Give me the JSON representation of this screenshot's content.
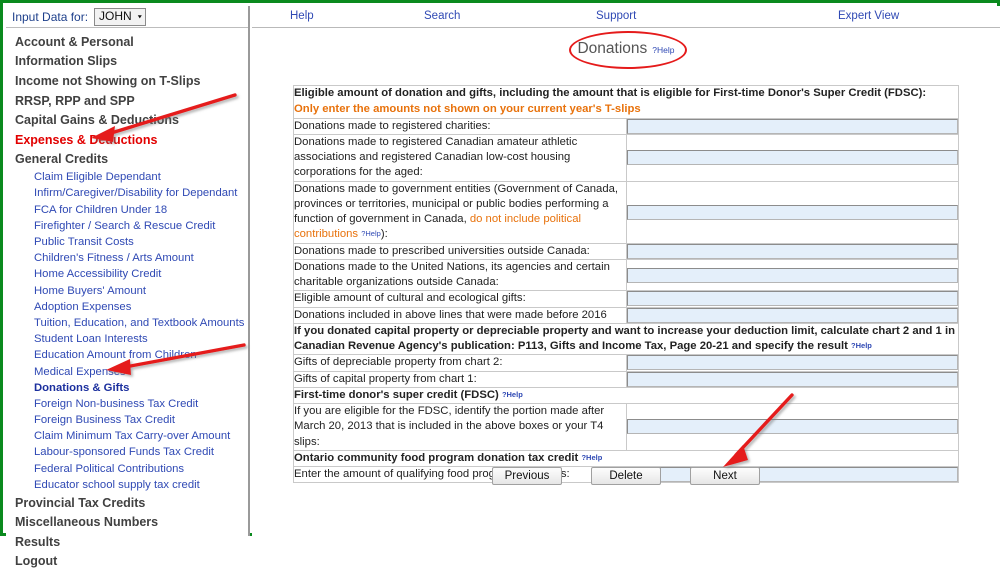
{
  "window": {
    "frame_color": "#0a8a1e",
    "annotation_color": "#e51b1b"
  },
  "input_bar": {
    "label": "Input Data for:",
    "selected_user": "JOHN",
    "caret": "▾"
  },
  "topnav": {
    "items": [
      {
        "label": "Help"
      },
      {
        "label": "Search"
      },
      {
        "label": "Support"
      },
      {
        "label": "Expert View"
      }
    ]
  },
  "sidebar": {
    "items": [
      {
        "label": "Account & Personal",
        "level": "top",
        "active": false
      },
      {
        "label": "Information Slips",
        "level": "top",
        "active": false
      },
      {
        "label": "Income not Showing on T-Slips",
        "level": "top",
        "active": false
      },
      {
        "label": "RRSP, RPP and SPP",
        "level": "top",
        "active": false
      },
      {
        "label": "Capital Gains & Deductions",
        "level": "top",
        "active": false
      },
      {
        "label": "Expenses & Deductions",
        "level": "top",
        "active": true
      },
      {
        "label": "General Credits",
        "level": "top",
        "active": false
      },
      {
        "label": "Claim Eligible Dependant",
        "level": "sub",
        "active": false
      },
      {
        "label": "Infirm/Caregiver/Disability for Dependant",
        "level": "sub",
        "active": false
      },
      {
        "label": "FCA for Children Under 18",
        "level": "sub",
        "active": false
      },
      {
        "label": "Firefighter / Search & Rescue Credit",
        "level": "sub",
        "active": false
      },
      {
        "label": "Public Transit Costs",
        "level": "sub",
        "active": false
      },
      {
        "label": "Children's Fitness / Arts Amount",
        "level": "sub",
        "active": false
      },
      {
        "label": "Home Accessibility Credit",
        "level": "sub",
        "active": false
      },
      {
        "label": "Home Buyers' Amount",
        "level": "sub",
        "active": false
      },
      {
        "label": "Adoption Expenses",
        "level": "sub",
        "active": false
      },
      {
        "label": "Tuition, Education, and Textbook Amounts",
        "level": "sub",
        "active": false
      },
      {
        "label": "Student Loan Interests",
        "level": "sub",
        "active": false
      },
      {
        "label": "Education Amount from Children",
        "level": "sub",
        "active": false
      },
      {
        "label": "Medical Expenses",
        "level": "sub",
        "active": false
      },
      {
        "label": "Donations & Gifts",
        "level": "sub",
        "active": true
      },
      {
        "label": "Foreign Non-business Tax Credit",
        "level": "sub",
        "active": false
      },
      {
        "label": "Foreign Business Tax Credit",
        "level": "sub",
        "active": false
      },
      {
        "label": "Claim Minimum Tax Carry-over Amount",
        "level": "sub",
        "active": false
      },
      {
        "label": "Labour-sponsored Funds Tax Credit",
        "level": "sub",
        "active": false
      },
      {
        "label": "Federal Political Contributions",
        "level": "sub",
        "active": false
      },
      {
        "label": "Educator school supply tax credit",
        "level": "sub",
        "active": false
      },
      {
        "label": "Provincial Tax Credits",
        "level": "top",
        "active": false
      },
      {
        "label": "Miscellaneous Numbers",
        "level": "top",
        "active": false
      },
      {
        "label": "Results",
        "level": "top",
        "active": false
      },
      {
        "label": "Logout",
        "level": "top",
        "active": false
      }
    ]
  },
  "page": {
    "title": "Donations",
    "title_help": "?Help"
  },
  "form": {
    "rows": [
      {
        "type": "section",
        "label": "Eligible amount of donation and gifts, including the amount that is eligible for First-time Donor's Super Credit (FDSC):",
        "sublabel": "Only enter the amounts not shown on your current year's T-slips",
        "bold": true,
        "field": false,
        "value": ""
      },
      {
        "type": "field",
        "label": "Donations made to registered charities:",
        "bold": false,
        "field": true,
        "value": ""
      },
      {
        "type": "field",
        "label": "Donations made to registered Canadian amateur athletic associations and registered Canadian low-cost housing corporations for the aged:",
        "bold": false,
        "field": true,
        "value": ""
      },
      {
        "type": "field",
        "label": "Donations made to government entities (Government of Canada, provinces or territories, municipal or public bodies performing a function of government in Canada,",
        "label_orange": "do not include political contributions",
        "label_help": "?Help",
        "label_tail": "):",
        "bold": false,
        "field": true,
        "value": ""
      },
      {
        "type": "field",
        "label": "Donations made to prescribed universities outside Canada:",
        "bold": false,
        "field": true,
        "value": ""
      },
      {
        "type": "field",
        "label": "Donations made to the United Nations, its agencies and certain charitable organizations outside Canada:",
        "bold": false,
        "field": true,
        "value": ""
      },
      {
        "type": "field",
        "label": "Eligible amount of cultural and ecological gifts:",
        "bold": false,
        "field": true,
        "value": ""
      },
      {
        "type": "field",
        "label": "Donations included in above lines that were made before 2016",
        "bold": false,
        "field": true,
        "value": ""
      },
      {
        "type": "section",
        "label": "If you donated capital property or depreciable property and want to increase your deduction limit, calculate chart 2 and 1 in Canadian Revenue Agency's publication: P113, Gifts and Income Tax, Page 20-21 and specify the result",
        "label_help": "?Help",
        "bold": true,
        "field": false,
        "value": ""
      },
      {
        "type": "field",
        "label": "Gifts of depreciable property from chart 2:",
        "bold": false,
        "field": true,
        "value": ""
      },
      {
        "type": "field",
        "label": "Gifts of capital property from chart 1:",
        "bold": false,
        "field": true,
        "value": ""
      },
      {
        "type": "section",
        "label": "First-time donor's super credit (FDSC)",
        "label_help": "?Help",
        "bold": true,
        "field": false,
        "value": ""
      },
      {
        "type": "field",
        "label": "If you are eligible for the FDSC, identify the portion made after March 20, 2013 that is included in the above boxes or your T4 slips:",
        "bold": false,
        "field": true,
        "value": ""
      },
      {
        "type": "section",
        "label": "Ontario community food program donation tax credit",
        "label_help": "?Help",
        "bold": true,
        "field": false,
        "value": ""
      },
      {
        "type": "field",
        "label": "Enter the amount of qualifying food program donations:",
        "bold": false,
        "field": true,
        "value": ""
      }
    ]
  },
  "buttons": {
    "previous": "Previous",
    "delete": "Delete",
    "next": "Next"
  }
}
